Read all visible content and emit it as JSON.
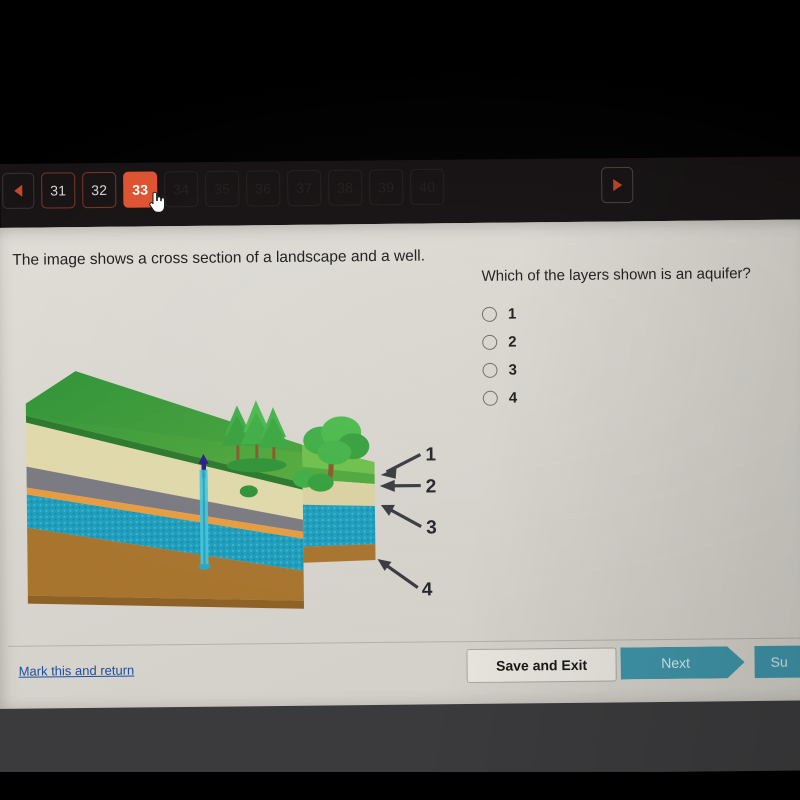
{
  "colors": {
    "accent_orange": "#e0512f",
    "teal_button": "#3e94a8",
    "link_blue": "#1f4fa3",
    "nav_background": "#171314",
    "card_background": "#d9d6d0",
    "layer_grass": "#6ec04a",
    "layer_grass_dark": "#2f9337",
    "layer_soil_cream": "#ded7a8",
    "layer_gray": "#7b7a82",
    "layer_aquifer": "#1f9ebd",
    "layer_bedrock": "#a9752e",
    "well_pipe": "#41c6dd",
    "well_cap": "#2d1f8f"
  },
  "pager": {
    "prev_icon": "triangle-left-icon",
    "next_icon": "triangle-right-icon",
    "buttons": [
      {
        "label": "31",
        "state": "visited"
      },
      {
        "label": "32",
        "state": "visited"
      },
      {
        "label": "33",
        "state": "current"
      },
      {
        "label": "34",
        "state": "dim"
      },
      {
        "label": "35",
        "state": "dim"
      },
      {
        "label": "36",
        "state": "dim"
      },
      {
        "label": "37",
        "state": "dim"
      },
      {
        "label": "38",
        "state": "dim"
      },
      {
        "label": "39",
        "state": "dim"
      },
      {
        "label": "40",
        "state": "dim"
      }
    ]
  },
  "stem": {
    "text": "The image shows a cross section of a landscape and a well."
  },
  "question": {
    "text": "Which of the layers shown is an aquifer?",
    "options": [
      {
        "label": "1",
        "selected": false
      },
      {
        "label": "2",
        "selected": false
      },
      {
        "label": "3",
        "selected": false
      },
      {
        "label": "4",
        "selected": false
      }
    ]
  },
  "diagram": {
    "alt": "isometric block diagram of a landscape cross section with a well",
    "callouts": [
      {
        "label": "1",
        "points_to": "topsoil / grass layer"
      },
      {
        "label": "2",
        "points_to": "cream sediment layer"
      },
      {
        "label": "3",
        "points_to": "blue saturated aquifer layer"
      },
      {
        "label": "4",
        "points_to": "brown bedrock layer"
      }
    ],
    "features": [
      "conifer-trees",
      "deciduous-tree",
      "shrubs",
      "water-well-pipe"
    ]
  },
  "footer": {
    "mark_link": "Mark this and return",
    "save_label": "Save and Exit",
    "next_label": "Next",
    "submit_label": "Su"
  }
}
